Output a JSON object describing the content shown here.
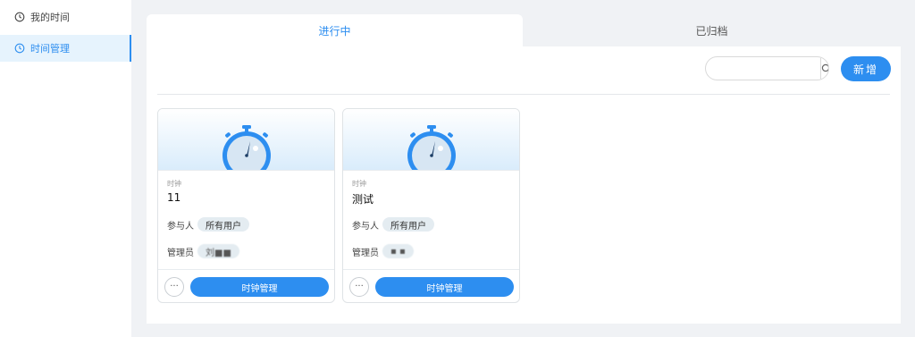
{
  "sidebar": {
    "items": [
      {
        "label": "我的时间",
        "icon": "clock-icon"
      },
      {
        "label": "时间管理",
        "icon": "clock-icon"
      }
    ]
  },
  "tabs": [
    {
      "label": "进行中"
    },
    {
      "label": "已归档"
    }
  ],
  "toolbar": {
    "search_placeholder": "",
    "search_value": "",
    "search_icon": "search-icon",
    "new_label": "新增"
  },
  "cards": [
    {
      "type": "时钟",
      "title": "11",
      "participants_label": "参与人",
      "participants_value": "所有用户",
      "admin_label": "管理员",
      "admin_value": "刘■■",
      "more_label": "···",
      "action_label": "时钟管理"
    },
    {
      "type": "时钟",
      "title": "测试",
      "participants_label": "参与人",
      "participants_value": "所有用户",
      "admin_label": "管理员",
      "admin_value": "▪ ▪",
      "more_label": "···",
      "action_label": "时钟管理"
    }
  ],
  "colors": {
    "accent": "#2d8ef0",
    "background": "#f0f2f5",
    "active_nav_bg": "#e6f3fd"
  }
}
